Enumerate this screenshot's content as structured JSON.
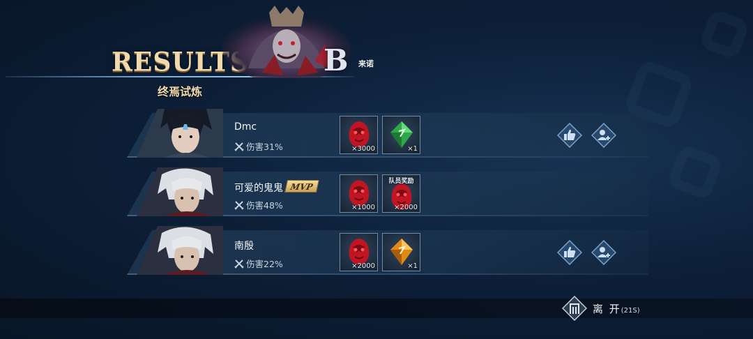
{
  "header": {
    "title": "RESULTS",
    "subtitle": "终焉试炼",
    "grade": "B",
    "boss_name": "来诺"
  },
  "players": [
    {
      "name": "Dmc",
      "mvp": false,
      "damage_label": "伤害31%",
      "portrait": "portrait-dark-hair",
      "rewards": [
        {
          "icon": "red-orb-icon",
          "qty": "×3000",
          "tag": ""
        },
        {
          "icon": "green-crystal-icon",
          "qty": "×1",
          "tag": ""
        }
      ],
      "actions": [
        "thumbs-up-icon",
        "add-friend-icon"
      ]
    },
    {
      "name": "可爱的鬼鬼",
      "mvp": true,
      "mvp_label": "MVP",
      "damage_label": "伤害48%",
      "portrait": "portrait-white-hair",
      "rewards": [
        {
          "icon": "red-orb-icon",
          "qty": "×1000",
          "tag": ""
        },
        {
          "icon": "red-orb-icon",
          "qty": "×2000",
          "tag": "队员奖励"
        }
      ],
      "actions": []
    },
    {
      "name": "南殷",
      "mvp": false,
      "damage_label": "伤害22%",
      "portrait": "portrait-white-hair",
      "rewards": [
        {
          "icon": "red-orb-icon",
          "qty": "×2000",
          "tag": ""
        },
        {
          "icon": "orange-crystal-icon",
          "qty": "×1",
          "tag": ""
        }
      ],
      "actions": [
        "thumbs-up-icon",
        "add-friend-icon"
      ]
    }
  ],
  "footer": {
    "leave_label": "离 开",
    "leave_timer": "(21S)"
  },
  "colors": {
    "accent_gold": "#efd9ad",
    "background": "#0d2039",
    "row_bg": "#284664"
  }
}
